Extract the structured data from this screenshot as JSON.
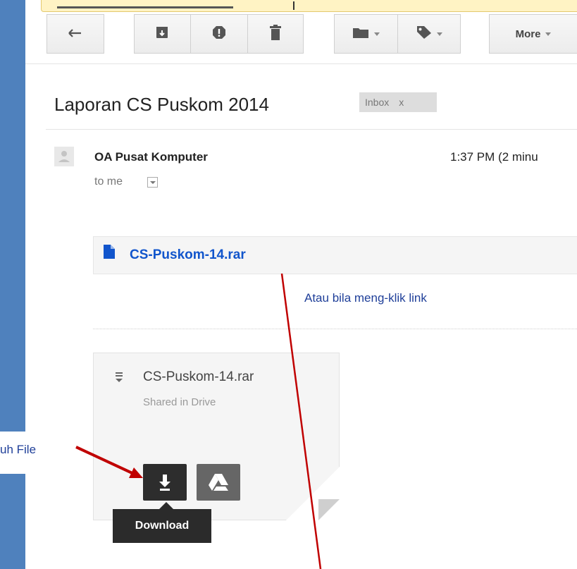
{
  "toolbar": {
    "more_label": "More",
    "buttons": [
      "back-icon",
      "archive-icon",
      "report-spam-icon",
      "delete-icon",
      "folder-icon",
      "label-icon"
    ]
  },
  "email": {
    "subject": "Laporan CS Puskom 2014",
    "label": "Inbox",
    "label_close": "x",
    "sender": "OA Pusat Komputer",
    "time": "1:37 PM (2 minu",
    "recipient": "to me"
  },
  "attachment": {
    "link_text": "CS-Puskom-14.rar",
    "card_title": "CS-Puskom-14.rar",
    "card_subtitle": "Shared in Drive",
    "download_tooltip": "Download"
  },
  "annotations": {
    "link_note": "Atau bila meng-klik link",
    "file_note": "uh File"
  },
  "colors": {
    "link_blue": "#1155cc",
    "annotation_blue": "#1f3f99",
    "arrow_red": "#c00000",
    "doc_strip": "#4f81bd"
  }
}
